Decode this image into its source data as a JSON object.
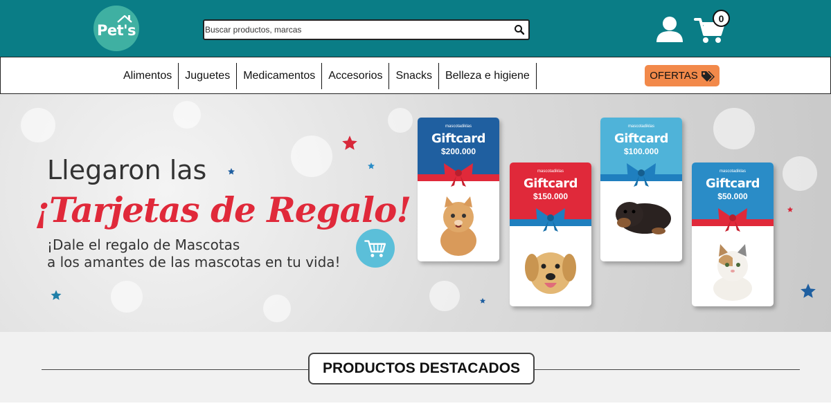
{
  "header": {
    "logo_text": "Pet's",
    "search_placeholder": "Buscar productos, marcas",
    "cart_count": "0",
    "icons": [
      "search-icon",
      "user-icon",
      "cart-icon"
    ]
  },
  "nav": {
    "items": [
      {
        "label": "Alimentos"
      },
      {
        "label": "Juguetes"
      },
      {
        "label": "Medicamentos"
      },
      {
        "label": "Accesorios"
      },
      {
        "label": "Snacks"
      },
      {
        "label": "Belleza e higiene"
      }
    ],
    "ofertas_label": "OFERTAS",
    "ofertas_icon": "tags-icon"
  },
  "banner": {
    "headline_line1": "Llegaron las",
    "headline_line2": "¡Tarjetas de Regalo!",
    "subtitle_line1": "¡Dale el regalo de Mascotas",
    "subtitle_line2": "a los amantes de las mascotas en tu vida!",
    "cards": [
      {
        "brand": "mascotadiklas",
        "title": "Giftcard",
        "amount": "$200.000",
        "color": "#1f5fa0",
        "ribbon": "#e0293a",
        "pet": "kitten"
      },
      {
        "brand": "mascotadiklas",
        "title": "Giftcard",
        "amount": "$150.000",
        "color": "#e0293a",
        "ribbon": "#1f7fbf",
        "pet": "golden-retriever"
      },
      {
        "brand": "mascotadiklas",
        "title": "Giftcard",
        "amount": "$100.000",
        "color": "#4fb3d9",
        "ribbon": "#1f7fbf",
        "pet": "rottweiler-puppy"
      },
      {
        "brand": "mascotadiklas",
        "title": "Giftcard",
        "amount": "$50.000",
        "color": "#2a8cc7",
        "ribbon": "#e0293a",
        "pet": "kitten"
      }
    ]
  },
  "featured": {
    "title": "PRODUCTOS DESTACADOS"
  },
  "colors": {
    "header_bg": "#0a7d86",
    "logo_bg": "#3fb0a2",
    "ofertas_bg": "#f2894a",
    "accent_red": "#e0293a"
  }
}
